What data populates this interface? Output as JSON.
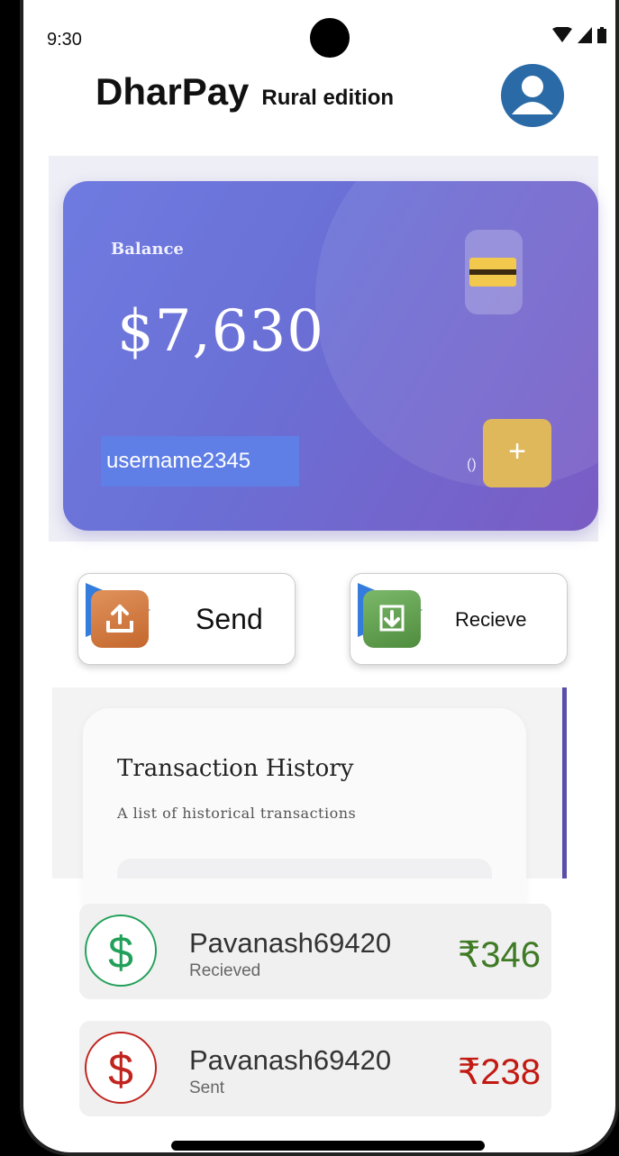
{
  "status": {
    "time": "9:30"
  },
  "header": {
    "app_name": "DharPay",
    "edition": "Rural edition"
  },
  "balance_card": {
    "label": "Balance",
    "amount": "$7,630",
    "username": "username2345",
    "tag": "()"
  },
  "actions": {
    "send_label": "Send",
    "receive_label": "Recieve"
  },
  "history": {
    "title": "Transaction History",
    "subtitle": "A list of historical transactions"
  },
  "transactions": [
    {
      "name": "Pavanash69420",
      "type": "Recieved",
      "amount": "₹346",
      "symbol": "$"
    },
    {
      "name": "Pavanash69420",
      "type": "Sent",
      "amount": "₹238",
      "symbol": "$"
    }
  ],
  "colors": {
    "received": "#22a05a",
    "sent": "#c0241f",
    "card": "#6f7be0"
  }
}
